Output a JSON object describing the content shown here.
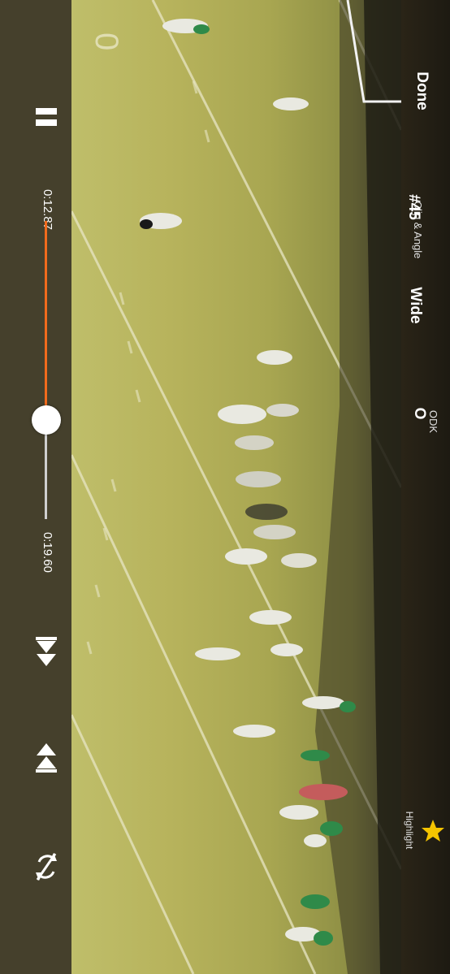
{
  "player": {
    "current_time": "0:12.87",
    "total_time": "0:19.60",
    "progress": 0.657
  },
  "toolbar": {
    "done_label": "Done",
    "clip_angle_label": "Clip & Angle",
    "clip_number": "#45",
    "angle_value": "Wide",
    "odk_label": "ODK",
    "odk_value": "O",
    "highlight_label": "Highlight"
  },
  "icons": {
    "pause": "pause-icon",
    "previous": "skip-previous-icon",
    "next": "skip-next-icon",
    "rotate": "rotate-lock-icon",
    "highlight": "star-icon"
  },
  "colors": {
    "controls_bg": "#45402c",
    "progress": "#f26b1d",
    "highlight_star": "#f5c400"
  }
}
